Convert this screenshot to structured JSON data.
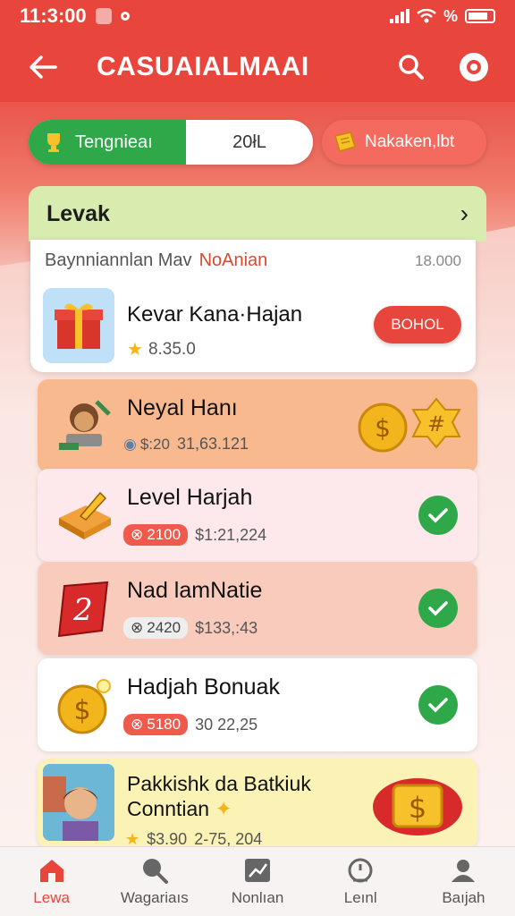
{
  "status_bar": {
    "time": "11:3:00",
    "battery_label": "%"
  },
  "app_bar": {
    "title": "CASUAIALMAAI"
  },
  "toggle": {
    "left_label": "Tengnieaı",
    "right_label": "20łL"
  },
  "top_pill": {
    "label": "Nakaken,lbt"
  },
  "levels": {
    "header": "Levak",
    "featured": {
      "subtitle": "Baynniannlan Mav",
      "subtitle_red": "NoAnian",
      "count": "18.000",
      "name": "Kevar Kana·Hajan",
      "rating": "8.35.0",
      "button": "BOHOL"
    },
    "rows": [
      {
        "name": "Neyal Hanı",
        "chip": "$:20",
        "value": "31,63.121",
        "bg": "#f9b98f",
        "done": false
      },
      {
        "name": "Level Harjah",
        "chip": "2100",
        "value": "$1:21,224",
        "bg": "#fde8ec",
        "done": true
      },
      {
        "name": "Nad lamNatie",
        "chip": "2420",
        "value": "$133,:43",
        "bg": "#f9cbbd",
        "done": true
      },
      {
        "name": "Hadjah Bonuak",
        "chip": "5180",
        "value": "30 22,25",
        "bg": "#ffffff",
        "done": true
      }
    ],
    "promo": {
      "name_line1": "Pakkishk da Batkiuk",
      "name_line2": "Conntian",
      "rating": "$3.90",
      "value": "2-75, 204"
    }
  },
  "bottom_nav": [
    {
      "label": "Lewa",
      "icon": "home-icon",
      "active": true
    },
    {
      "label": "Wagariaıs",
      "icon": "search-icon",
      "active": false
    },
    {
      "label": "Nonlıan",
      "icon": "chart-icon",
      "active": false
    },
    {
      "label": "Leınl",
      "icon": "timer-icon",
      "active": false
    },
    {
      "label": "Baıjah",
      "icon": "profile-icon",
      "active": false
    }
  ],
  "colors": {
    "accent": "#e8463c",
    "success": "#2fa84a",
    "header_green": "#d8ecb0"
  }
}
